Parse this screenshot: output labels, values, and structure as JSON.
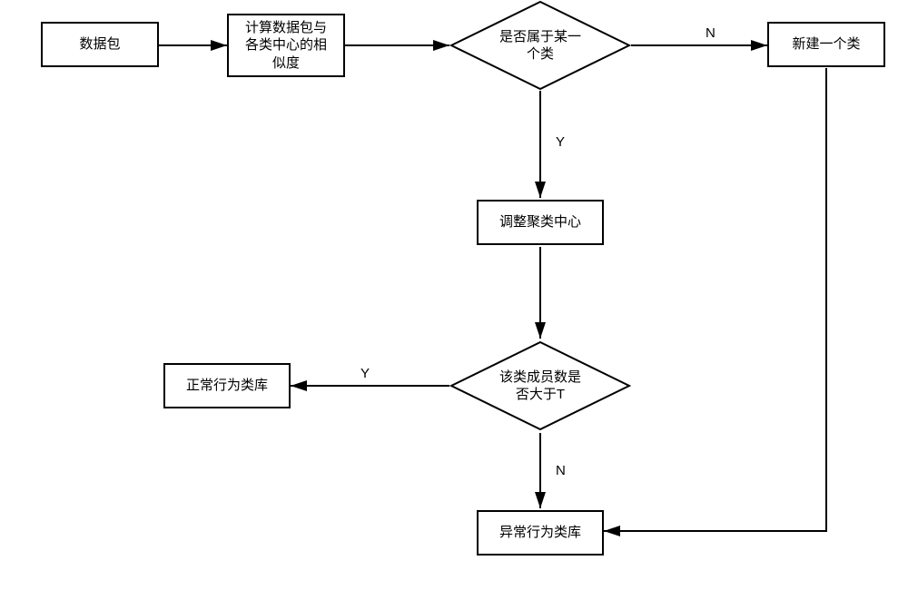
{
  "nodes": {
    "n1": {
      "label": "数据包"
    },
    "n2": {
      "label": "计算数据包与\n各类中心的相\n似度"
    },
    "d1": {
      "label": "是否属于某一\n个类"
    },
    "n3": {
      "label": "新建一个类"
    },
    "n4": {
      "label": "调整聚类中心"
    },
    "d2": {
      "label": "该类成员数是\n否大于T"
    },
    "n5": {
      "label": "正常行为类库"
    },
    "n6": {
      "label": "异常行为类库"
    }
  },
  "edges": {
    "e_d1_n3": {
      "label": "N"
    },
    "e_d1_n4": {
      "label": "Y"
    },
    "e_d2_n5": {
      "label": "Y"
    },
    "e_d2_n6": {
      "label": "N"
    }
  }
}
